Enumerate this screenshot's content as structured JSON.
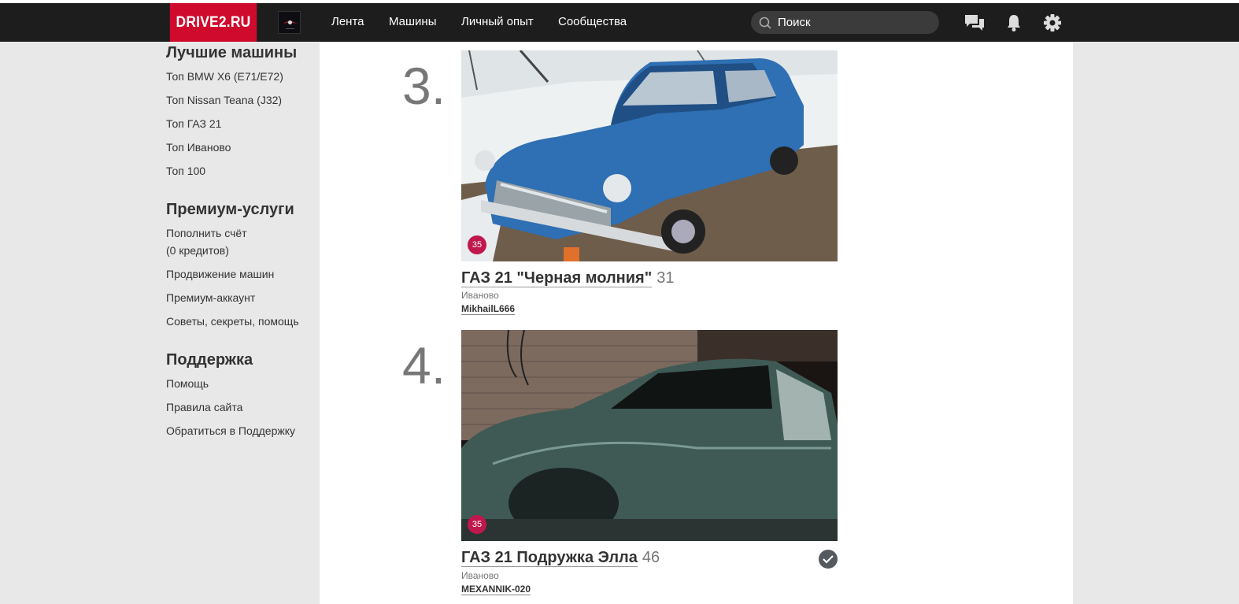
{
  "header": {
    "logo": "DRIVE2.RU",
    "nav": [
      "Лента",
      "Машины",
      "Личный опыт",
      "Сообщества"
    ],
    "search_placeholder": "Поиск"
  },
  "sidebar": {
    "best_cars": {
      "heading": "Лучшие машины",
      "links": [
        "Топ BMW X6 (E71/E72)",
        "Топ Nissan Teana (J32)",
        "Топ ГАЗ 21",
        "Топ Иваново",
        "Топ 100"
      ]
    },
    "premium": {
      "heading": "Премиум-услуги",
      "links": [
        "Пополнить счёт",
        "(0 кредитов)",
        "Продвижение машин",
        "Премиум-аккаунт",
        "Советы, секреты, помощь"
      ]
    },
    "support": {
      "heading": "Поддержка",
      "links": [
        "Помощь",
        "Правила сайта",
        "Обратиться в Поддержку"
      ]
    }
  },
  "cars": [
    {
      "rank": "3.",
      "badge": "35",
      "title": "ГАЗ 21 \"Черная молния\"",
      "count": "31",
      "city": "Иваново",
      "user": "MikhailL666",
      "photo_colors": {
        "body": "#2f6fb3",
        "ground": "#6b5b48",
        "snow": "#e6ecf0"
      }
    },
    {
      "rank": "4.",
      "badge": "35",
      "title": "ГАЗ 21 Подружка Элла",
      "count": "46",
      "city": "Иваново",
      "user": "MEXANNIK-020",
      "photo_colors": {
        "body": "#4d6b64",
        "wall": "#7a6a60",
        "dark": "#151210"
      }
    }
  ],
  "colors": {
    "brand": "#cf0a2c",
    "navbar": "#1d1d1d",
    "badge": "#c0174d"
  }
}
